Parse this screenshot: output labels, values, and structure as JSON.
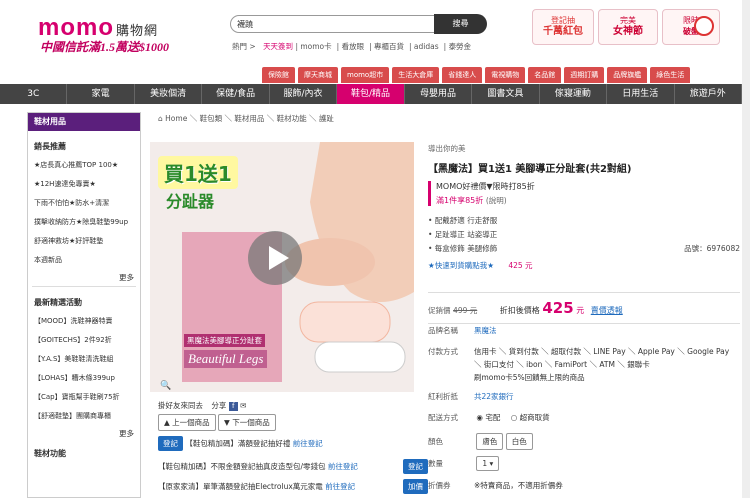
{
  "header": {
    "logo": "momo",
    "logo_sub": "購物網",
    "tagline": "中國信託滿1.5萬送$1000",
    "search_value": "襪蹺",
    "search_button": "搜尋",
    "quick_links": [
      "熱門 >",
      "天天簽到",
      "momo卡",
      "看放眼",
      "專櫃百貨",
      "adidas",
      "泰勞金"
    ],
    "promos": [
      {
        "line1": "登記抽",
        "line2": "千萬紅包",
        "color": "#e44"
      },
      {
        "line1": "完美",
        "line2": "女神節",
        "color": "#c03"
      },
      {
        "line1": "限時",
        "line2": "破盤",
        "color": "#c03"
      }
    ]
  },
  "category_tabs": [
    "保險館",
    "摩天商城",
    "momo超市",
    "生活大倉庫",
    "省錢達人",
    "電視購物",
    "名品館",
    "週期訂購",
    "品牌旗艦",
    "綠色生活"
  ],
  "nav": [
    "3C",
    "家電",
    "美妝個清",
    "保健/食品",
    "服飾/內衣",
    "鞋包/精品",
    "母嬰用品",
    "圖書文具",
    "傢寢運動",
    "日用生活",
    "旅遊戶外"
  ],
  "sidebar": {
    "heading": "鞋材用品",
    "section1_title": "銷長推薦",
    "section1_items": [
      "★店長真心推薦TOP 100★",
      "★12H速達免專賣★",
      "下雨不怕怕★防水+清潔",
      "撲擊收納防方★除臭鞋墊99up",
      "舒適神救坊★好評鞋墊",
      "本週新品"
    ],
    "more1": "更多",
    "section2_title": "最新精選活動",
    "section2_items": [
      "【MOOD】洗鞋神器特賣",
      "【GOITECHS】2件92折",
      "【Y.A.S】美鞋鞋清洗鞋組",
      "【LOHAS】糟木條399up",
      "【Cap】寶瓶幫手鞋刷75折",
      "【舒適鞋墊】團購商專櫃"
    ],
    "more2": "更多",
    "section3_title": "鞋材功能"
  },
  "breadcrumb": [
    "Home",
    "鞋包類",
    "鞋材用品",
    "鞋材功能",
    "護趾"
  ],
  "product": {
    "brand_small": "導出你的美",
    "title": "【黑魔法】買1送1 美腳導正分趾套(共2對組)",
    "promo_line1": "MOMO好禮價▼限時打85折",
    "promo_line2": "滿1件享85折",
    "promo_note": "(說明)",
    "features": [
      "• 配戴舒適 行走舒服",
      "• 足趾導正 站姿導正",
      "• 每盒修飾 美腿修飾"
    ],
    "code_label": "品號：",
    "code_value": "6976082",
    "speed_note": "★快速到貨購點我★",
    "speed_price": "425 元",
    "img_text1": "買1送1",
    "img_text2": "分趾器",
    "img_box_title": "黑魔法美腳導正分趾套",
    "img_box_sub": "Beautiful Legs"
  },
  "price": {
    "original_label": "促銷價",
    "original_value": "499 元",
    "sale_label": "折扣後價格",
    "sale_value": "425",
    "sale_unit": "元",
    "link": "賣價透報"
  },
  "specs": {
    "name_label": "品牌名稱",
    "name_value": "黑魔法",
    "pay_label": "付款方式",
    "pay_line1": "信用卡 ＼ 貨到付款 ＼ 超取付款 ＼ LINE Pay ＼ Apple Pay ＼ Google Pay",
    "pay_line2": "＼ 街口支付 ＼ ibon ＼ FamiPort ＼ ATM ＼ 銀聯卡",
    "pay_line3": "刷momo卡5%回饋無上限的商品",
    "bonus_label": "紅利折抵",
    "bonus_value": "共22家銀行",
    "ship_label": "配送方式",
    "ship_opt1": "宅配",
    "ship_opt2": "超商取貨",
    "color_label": "顏色",
    "color_opt1": "膚色",
    "color_opt2": "白色",
    "qty_label": "數量",
    "qty_value": "1",
    "coupon_label": "折價券",
    "coupon_value": "※特賣商品，不適用折價券"
  },
  "share": {
    "fb_label": "掛好友來同去",
    "share_label": "分享",
    "prev": "上一個商品",
    "next": "下一個商品"
  },
  "coupons": [
    {
      "btn": "登記",
      "text": "【鞋包精加碼】滿額登記抽好禮",
      "link": "前往登記"
    },
    {
      "btn": "",
      "text": "【鞋包精加碼】不限金額登記抽真皮造型包/零錢包",
      "link": "前往登記",
      "btn2": "登記"
    },
    {
      "btn": "",
      "text": "【原家家清】單筆滿額登記抽Electrolux萬元家電",
      "link": "前往登記",
      "btn2": "加價"
    }
  ]
}
